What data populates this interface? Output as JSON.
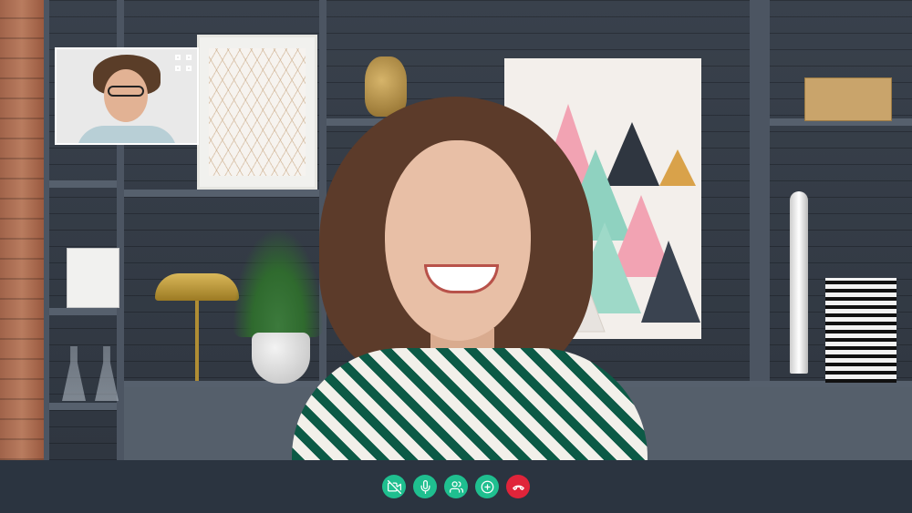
{
  "call": {
    "main_participant": "remote-participant-video",
    "self_view": "self-view-video"
  },
  "controls": [
    {
      "name": "camera-toggle-button",
      "icon": "video-off-icon",
      "color": "#1fbf8f"
    },
    {
      "name": "microphone-button",
      "icon": "microphone-icon",
      "color": "#1fbf8f"
    },
    {
      "name": "participants-button",
      "icon": "users-icon",
      "color": "#1fbf8f"
    },
    {
      "name": "add-participant-button",
      "icon": "plus-circle-icon",
      "color": "#1fbf8f"
    },
    {
      "name": "end-call-button",
      "icon": "phone-hangup-icon",
      "color": "#e0243a"
    }
  ],
  "colors": {
    "control_bar_bg": "#2b3440",
    "accent_green": "#1fbf8f",
    "hangup_red": "#e0243a"
  }
}
